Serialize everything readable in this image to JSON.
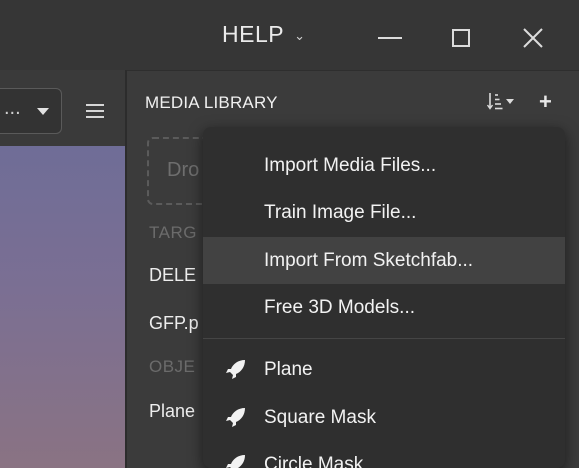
{
  "titlebar": {
    "help_label": "HELP",
    "help_chevron": "⌄"
  },
  "toolbar": {
    "dropdown_value": "..."
  },
  "media_library": {
    "title": "MEDIA LIBRARY",
    "sort_icon": "sort-icon",
    "add_icon": "+",
    "drop_zone_text": "Dro",
    "target_section": "TARG",
    "target_items": [
      "DELE",
      "GFP.p"
    ],
    "object_section": "OBJE",
    "object_items": [
      "Plane"
    ]
  },
  "context_menu": {
    "items": [
      {
        "label": "Import Media Files...",
        "icon": null
      },
      {
        "label": "Train Image File...",
        "icon": null
      },
      {
        "label": "Import From Sketchfab...",
        "icon": null,
        "highlighted": true
      },
      {
        "label": "Free 3D Models...",
        "icon": null
      },
      {
        "label": "Plane",
        "icon": "rocket-icon"
      },
      {
        "label": "Square Mask",
        "icon": "rocket-icon"
      },
      {
        "label": "Circle Mask",
        "icon": "rocket-icon"
      }
    ]
  },
  "colors": {
    "background": "#3a3a3a",
    "menu_bg": "#2f2f2f",
    "menu_highlight": "#424242",
    "viewport_top": "#6f6d97",
    "viewport_bottom": "#8a7383"
  }
}
